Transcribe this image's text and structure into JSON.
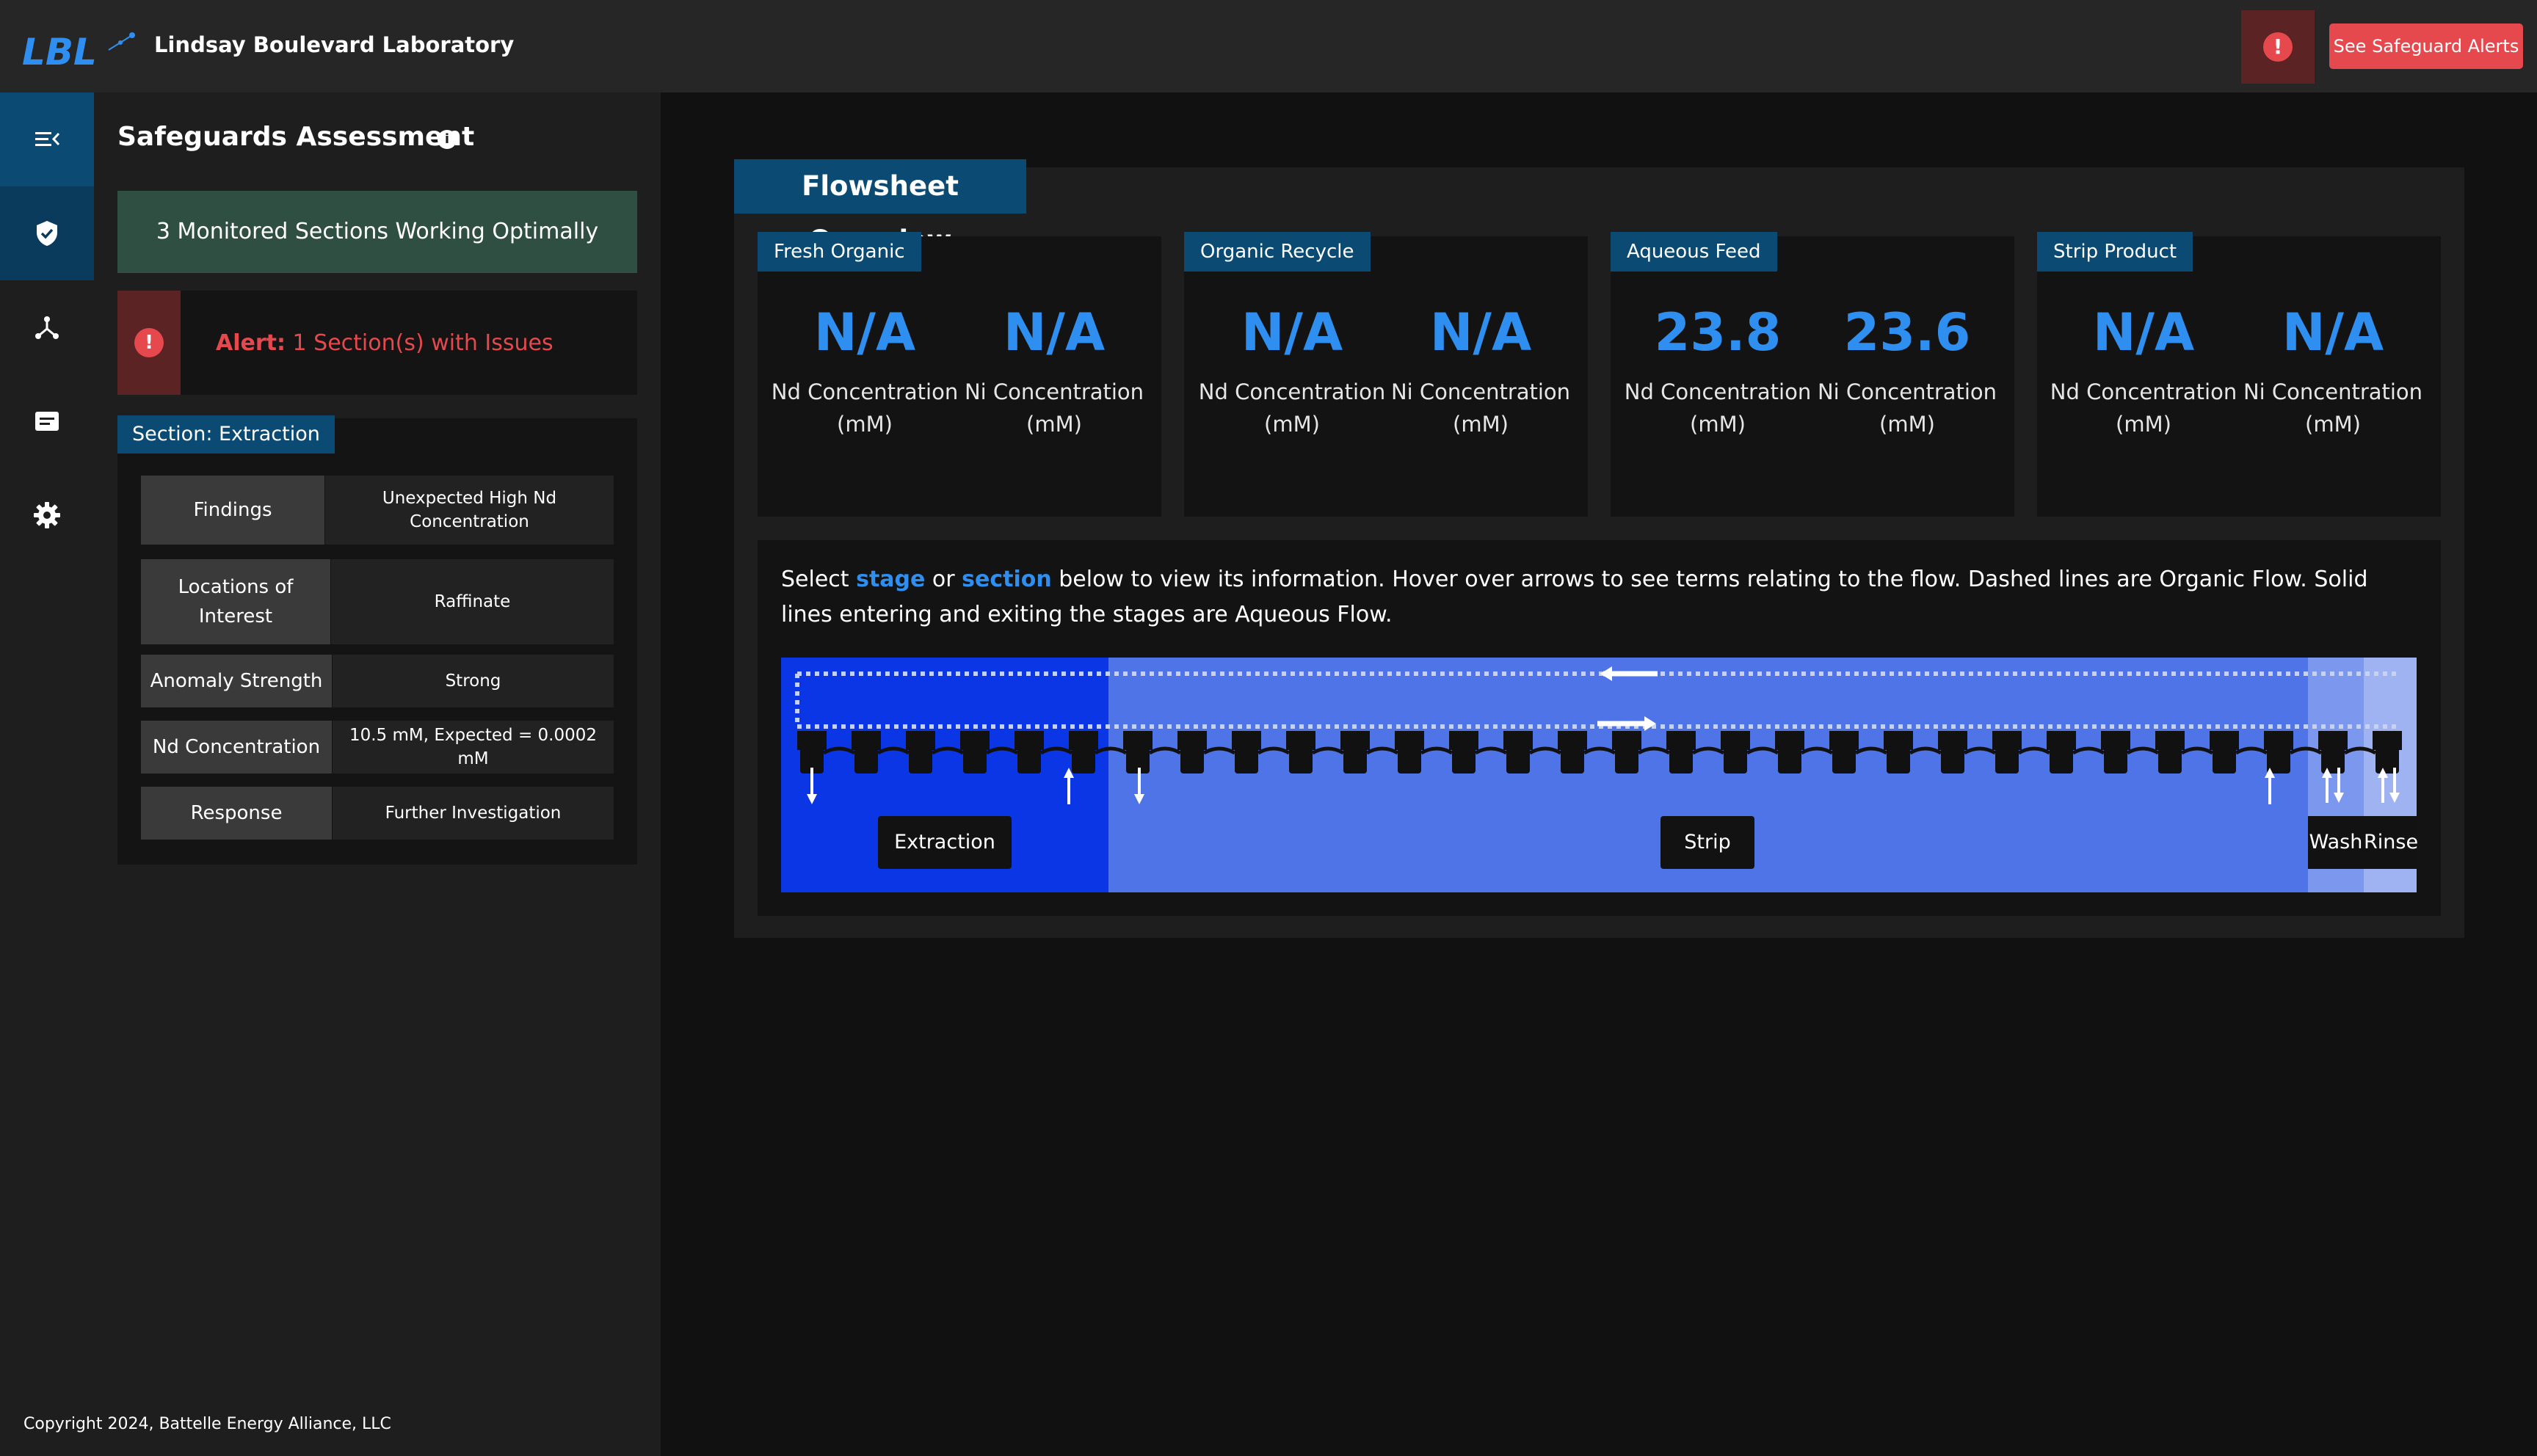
{
  "app": {
    "title": "Lindsay Boulevard Laboratory",
    "logo_text": "LBL",
    "alert_button": "See Safeguard Alerts"
  },
  "rail": {
    "items": [
      "menu-collapse-icon",
      "shield-check-icon",
      "network-icon",
      "document-icon",
      "gear-icon"
    ],
    "active": "shield-check-icon"
  },
  "safeguards": {
    "title": "Safeguards Assessment",
    "status_ok": "3 Monitored Sections Working Optimally",
    "alert_prefix": "Alert:",
    "alert_text": "1 Section(s) with Issues",
    "section_tag": "Section: Extraction",
    "rows": [
      {
        "label": "Findings",
        "value": "Unexpected High Nd Concentration"
      },
      {
        "label": "Locations of Interest",
        "value": "Raffinate"
      },
      {
        "label": "Anomaly Strength",
        "value": "Strong"
      },
      {
        "label": "Nd Concentration",
        "value": "10.5 mM, Expected = 0.0002 mM"
      },
      {
        "label": "Response",
        "value": "Further Investigation"
      }
    ]
  },
  "overview": {
    "title": "Flowsheet Overview",
    "cards": [
      {
        "tag": "Fresh Organic",
        "nd_value": "N/A",
        "nd_label": "Nd Concentration (mM)",
        "ni_value": "N/A",
        "ni_label": "Ni Concentration (mM)"
      },
      {
        "tag": "Organic Recycle",
        "nd_value": "N/A",
        "nd_label": "Nd Concentration (mM)",
        "ni_value": "N/A",
        "ni_label": "Ni Concentration (mM)"
      },
      {
        "tag": "Aqueous Feed",
        "nd_value": "23.8",
        "nd_label": "Nd Concentration (mM)",
        "ni_value": "23.6",
        "ni_label": "Ni Concentration (mM)"
      },
      {
        "tag": "Strip Product",
        "nd_value": "N/A",
        "nd_label": "Nd Concentration (mM)",
        "ni_value": "N/A",
        "ni_label": "Ni Concentration (mM)"
      }
    ],
    "instructions": {
      "t1": "Select ",
      "k1": "stage",
      "t2": " or ",
      "k2": "section",
      "t3": " below to view its information. Hover over arrows to see terms relating to the flow. Dashed lines are Organic Flow. Solid lines entering and exiting the stages are Aqueous Flow."
    },
    "sections": [
      {
        "name": "Extraction",
        "color": "#0a36e6"
      },
      {
        "name": "Strip",
        "color": "#4f74e8"
      },
      {
        "name": "Wash",
        "color": "#7b97ee"
      },
      {
        "name": "Rinse",
        "color": "#9fb3f3"
      }
    ]
  },
  "footer": {
    "copyright": "Copyright 2024, Battelle Energy Alliance, LLC"
  }
}
